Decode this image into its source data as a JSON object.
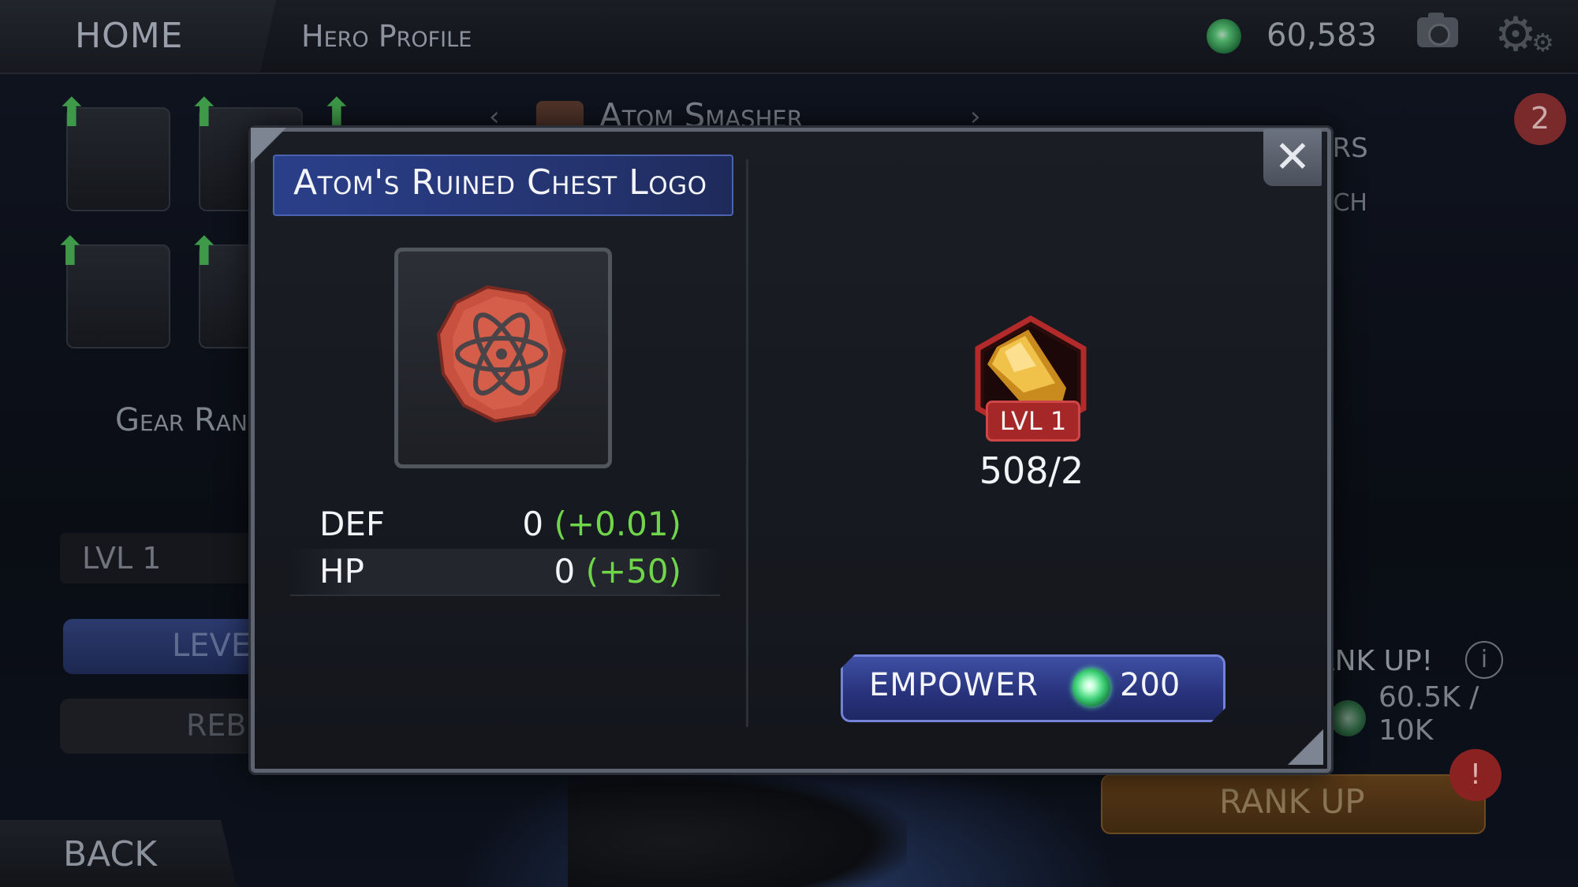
{
  "header": {
    "home_label": "HOME",
    "profile_label": "Hero Profile",
    "units_value": "60,583",
    "units_icon": "units-crystal-icon",
    "camera_icon": "camera-icon",
    "settings_icon": "gear-icon"
  },
  "hero": {
    "name": "Atom Smasher",
    "prev_arrow": "‹",
    "next_arrow": "›"
  },
  "background_left": {
    "gear_rank_label": "Gear Ran",
    "lvl_label": "LVL 1",
    "level_button_label": "LEVE",
    "rebirth_button_label": "REBI",
    "back_label": "BACK"
  },
  "background_right": {
    "text_line1": "ERS",
    "text_line2": "NCH",
    "notification_count": "2",
    "rankup_text": "ANK UP!",
    "info_label": "i",
    "cost_text": "60.5K /\n10K",
    "rankup_button_label": "RANK UP",
    "alert_label": "!"
  },
  "modal": {
    "title": "Atom's Ruined Chest Logo",
    "close_label": "✕",
    "stats": [
      {
        "name": "DEF",
        "value": "0",
        "bonus": "(+0.01)"
      },
      {
        "name": "HP",
        "value": "0",
        "bonus": "(+50)"
      }
    ],
    "crystal": {
      "level_label": "LVL 1",
      "count": "508/2"
    },
    "empower": {
      "label": "EMPOWER",
      "cost": "200"
    }
  },
  "colors": {
    "stat_bonus": "#6fd64a",
    "title_bar": "#2a3f8a",
    "empower_button": "#27327a",
    "level_badge": "#a52727"
  }
}
